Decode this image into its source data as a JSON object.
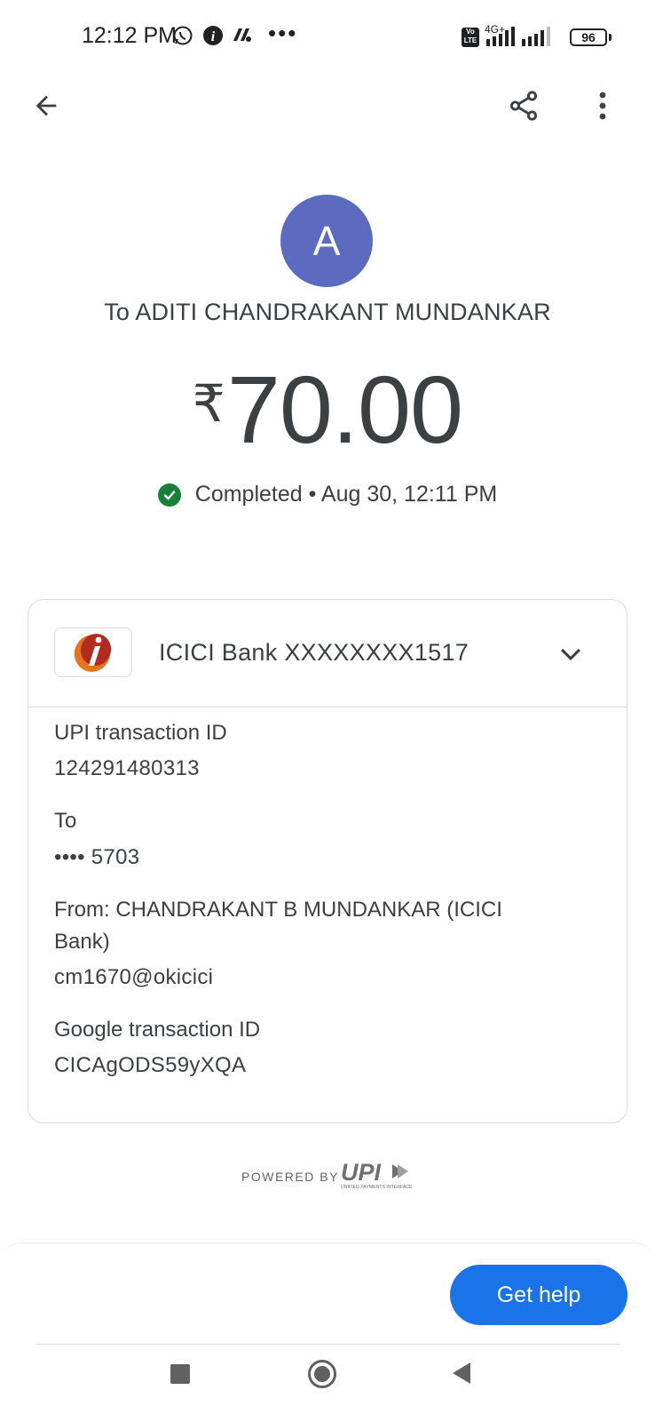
{
  "status_bar": {
    "time": "12:12 PM",
    "network": "4G+",
    "volte": "Vo LTE",
    "battery": "96"
  },
  "payee": {
    "avatar_letter": "A",
    "recipient_line": "To ADITI CHANDRAKANT MUNDANKAR"
  },
  "amount": {
    "currency": "₹",
    "value": "70.00"
  },
  "status": {
    "text": "Completed • Aug 30, 12:11 PM",
    "color": "#188038"
  },
  "bank": {
    "name": "ICICI Bank XXXXXXXX1517"
  },
  "details": {
    "upi_label": "UPI transaction ID",
    "upi_value": "124291480313",
    "to_label": "To",
    "to_value": "•••• 5703",
    "from_line1": "From: CHANDRAKANT B MUNDANKAR (ICICI",
    "from_line2": "Bank)",
    "from_value": "cm1670@okicici",
    "google_label": "Google transaction ID",
    "google_value": "CICAgODS59yXQA"
  },
  "footer": {
    "powered_by": "POWERED BY",
    "upi_logo_text": "UPI",
    "upi_logo_subtext": "UNIFIED PAYMENTS INTERFACE"
  },
  "actions": {
    "get_help": "Get help"
  },
  "colors": {
    "accent": "#1a73e8",
    "avatar": "#5c6bc0",
    "bank_logo": "#e05a1e"
  }
}
